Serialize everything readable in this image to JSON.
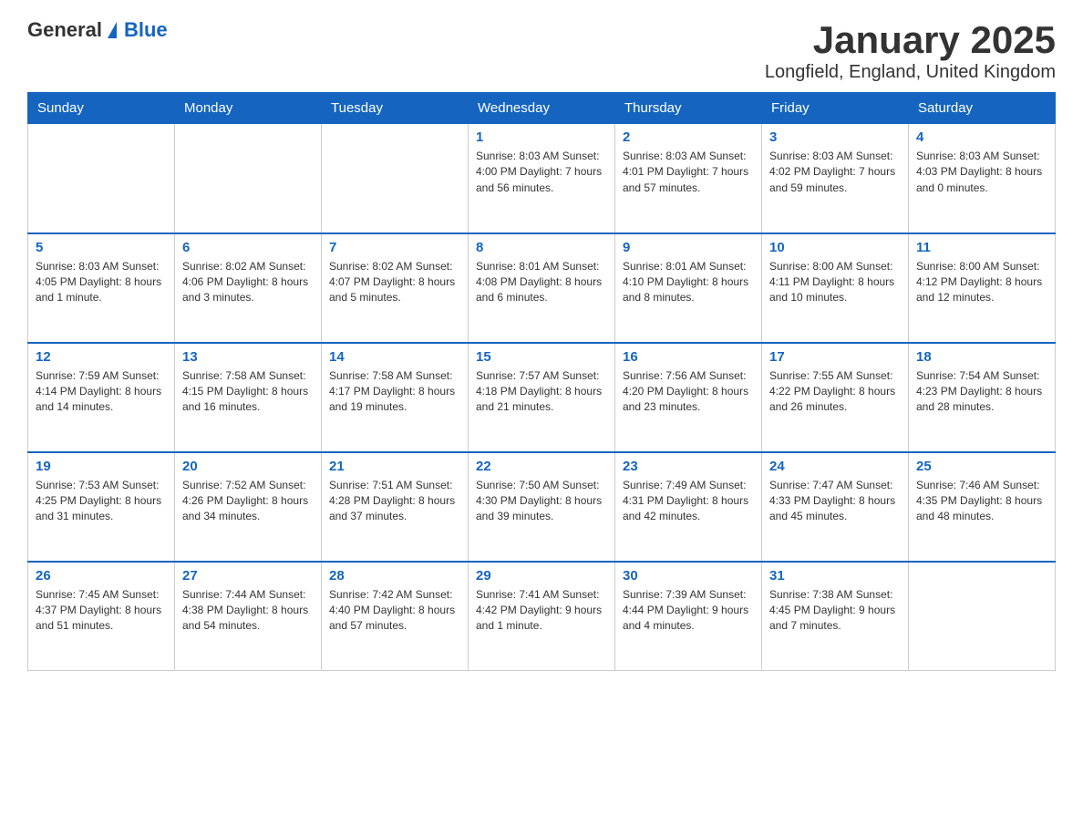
{
  "header": {
    "logo_general": "General",
    "logo_blue": "Blue",
    "title": "January 2025",
    "subtitle": "Longfield, England, United Kingdom"
  },
  "days_of_week": [
    "Sunday",
    "Monday",
    "Tuesday",
    "Wednesday",
    "Thursday",
    "Friday",
    "Saturday"
  ],
  "weeks": [
    [
      {
        "day": "",
        "info": ""
      },
      {
        "day": "",
        "info": ""
      },
      {
        "day": "",
        "info": ""
      },
      {
        "day": "1",
        "info": "Sunrise: 8:03 AM\nSunset: 4:00 PM\nDaylight: 7 hours\nand 56 minutes."
      },
      {
        "day": "2",
        "info": "Sunrise: 8:03 AM\nSunset: 4:01 PM\nDaylight: 7 hours\nand 57 minutes."
      },
      {
        "day": "3",
        "info": "Sunrise: 8:03 AM\nSunset: 4:02 PM\nDaylight: 7 hours\nand 59 minutes."
      },
      {
        "day": "4",
        "info": "Sunrise: 8:03 AM\nSunset: 4:03 PM\nDaylight: 8 hours\nand 0 minutes."
      }
    ],
    [
      {
        "day": "5",
        "info": "Sunrise: 8:03 AM\nSunset: 4:05 PM\nDaylight: 8 hours\nand 1 minute."
      },
      {
        "day": "6",
        "info": "Sunrise: 8:02 AM\nSunset: 4:06 PM\nDaylight: 8 hours\nand 3 minutes."
      },
      {
        "day": "7",
        "info": "Sunrise: 8:02 AM\nSunset: 4:07 PM\nDaylight: 8 hours\nand 5 minutes."
      },
      {
        "day": "8",
        "info": "Sunrise: 8:01 AM\nSunset: 4:08 PM\nDaylight: 8 hours\nand 6 minutes."
      },
      {
        "day": "9",
        "info": "Sunrise: 8:01 AM\nSunset: 4:10 PM\nDaylight: 8 hours\nand 8 minutes."
      },
      {
        "day": "10",
        "info": "Sunrise: 8:00 AM\nSunset: 4:11 PM\nDaylight: 8 hours\nand 10 minutes."
      },
      {
        "day": "11",
        "info": "Sunrise: 8:00 AM\nSunset: 4:12 PM\nDaylight: 8 hours\nand 12 minutes."
      }
    ],
    [
      {
        "day": "12",
        "info": "Sunrise: 7:59 AM\nSunset: 4:14 PM\nDaylight: 8 hours\nand 14 minutes."
      },
      {
        "day": "13",
        "info": "Sunrise: 7:58 AM\nSunset: 4:15 PM\nDaylight: 8 hours\nand 16 minutes."
      },
      {
        "day": "14",
        "info": "Sunrise: 7:58 AM\nSunset: 4:17 PM\nDaylight: 8 hours\nand 19 minutes."
      },
      {
        "day": "15",
        "info": "Sunrise: 7:57 AM\nSunset: 4:18 PM\nDaylight: 8 hours\nand 21 minutes."
      },
      {
        "day": "16",
        "info": "Sunrise: 7:56 AM\nSunset: 4:20 PM\nDaylight: 8 hours\nand 23 minutes."
      },
      {
        "day": "17",
        "info": "Sunrise: 7:55 AM\nSunset: 4:22 PM\nDaylight: 8 hours\nand 26 minutes."
      },
      {
        "day": "18",
        "info": "Sunrise: 7:54 AM\nSunset: 4:23 PM\nDaylight: 8 hours\nand 28 minutes."
      }
    ],
    [
      {
        "day": "19",
        "info": "Sunrise: 7:53 AM\nSunset: 4:25 PM\nDaylight: 8 hours\nand 31 minutes."
      },
      {
        "day": "20",
        "info": "Sunrise: 7:52 AM\nSunset: 4:26 PM\nDaylight: 8 hours\nand 34 minutes."
      },
      {
        "day": "21",
        "info": "Sunrise: 7:51 AM\nSunset: 4:28 PM\nDaylight: 8 hours\nand 37 minutes."
      },
      {
        "day": "22",
        "info": "Sunrise: 7:50 AM\nSunset: 4:30 PM\nDaylight: 8 hours\nand 39 minutes."
      },
      {
        "day": "23",
        "info": "Sunrise: 7:49 AM\nSunset: 4:31 PM\nDaylight: 8 hours\nand 42 minutes."
      },
      {
        "day": "24",
        "info": "Sunrise: 7:47 AM\nSunset: 4:33 PM\nDaylight: 8 hours\nand 45 minutes."
      },
      {
        "day": "25",
        "info": "Sunrise: 7:46 AM\nSunset: 4:35 PM\nDaylight: 8 hours\nand 48 minutes."
      }
    ],
    [
      {
        "day": "26",
        "info": "Sunrise: 7:45 AM\nSunset: 4:37 PM\nDaylight: 8 hours\nand 51 minutes."
      },
      {
        "day": "27",
        "info": "Sunrise: 7:44 AM\nSunset: 4:38 PM\nDaylight: 8 hours\nand 54 minutes."
      },
      {
        "day": "28",
        "info": "Sunrise: 7:42 AM\nSunset: 4:40 PM\nDaylight: 8 hours\nand 57 minutes."
      },
      {
        "day": "29",
        "info": "Sunrise: 7:41 AM\nSunset: 4:42 PM\nDaylight: 9 hours\nand 1 minute."
      },
      {
        "day": "30",
        "info": "Sunrise: 7:39 AM\nSunset: 4:44 PM\nDaylight: 9 hours\nand 4 minutes."
      },
      {
        "day": "31",
        "info": "Sunrise: 7:38 AM\nSunset: 4:45 PM\nDaylight: 9 hours\nand 7 minutes."
      },
      {
        "day": "",
        "info": ""
      }
    ]
  ]
}
